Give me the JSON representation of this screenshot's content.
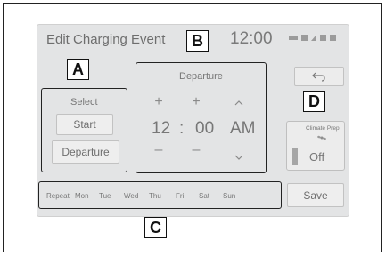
{
  "screen": {
    "title": "Edit Charging Event",
    "clock": "12:00",
    "status_icons": [
      "signal-icon",
      "battery-icon",
      "network-icon",
      "wifi-icon",
      "gps-icon"
    ]
  },
  "callouts": {
    "a": "A",
    "b": "B",
    "c": "C",
    "d": "D"
  },
  "select_panel": {
    "label": "Select",
    "start_label": "Start",
    "departure_label": "Departure"
  },
  "time_panel": {
    "label": "Departure",
    "hour": "12",
    "separator": ":",
    "minute": "00",
    "ampm": "AM",
    "plus": "+",
    "minus": "–"
  },
  "days": {
    "repeat_label": "Repeat",
    "items": [
      "Mon",
      "Tue",
      "Wed",
      "Thu",
      "Fri",
      "Sat",
      "Sun"
    ]
  },
  "climate": {
    "label": "Climate Prep",
    "state": "Off"
  },
  "save_label": "Save"
}
